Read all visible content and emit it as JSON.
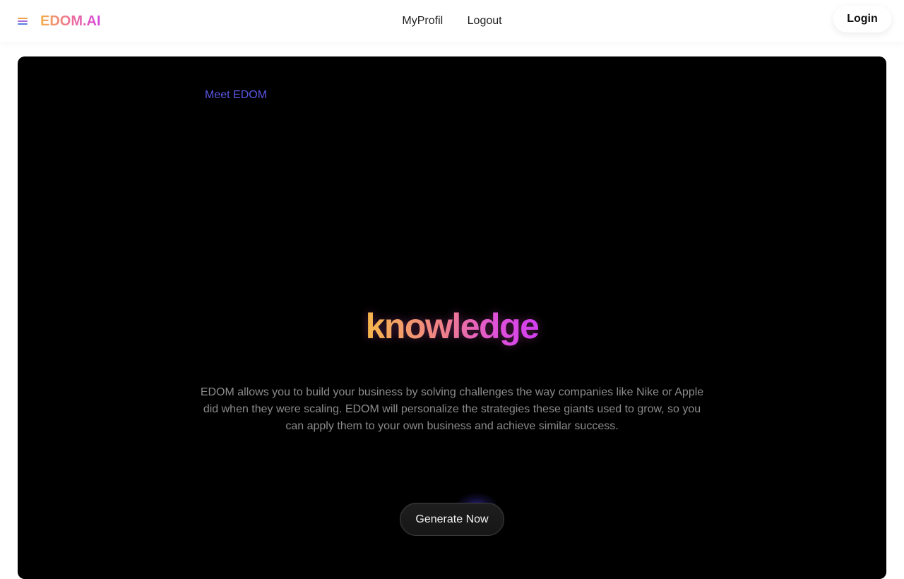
{
  "navbar": {
    "menu_icon": "hamburger-menu-icon",
    "brand": "EDOM.AI",
    "links": [
      {
        "label": "MyProfil"
      },
      {
        "label": "Logout"
      }
    ],
    "login_label": "Login"
  },
  "hero": {
    "eyebrow": "Meet EDOM",
    "headline": "knowledge",
    "description": "EDOM allows you to build your business by solving challenges the way companies like Nike or Apple did when they were scaling. EDOM will personalize the strategies these giants used to grow, so you can apply them to your own business and achieve similar success.",
    "cta_label": "Generate Now"
  },
  "colors": {
    "accent": "#5b57e6",
    "gradient_start": "#f3b049",
    "gradient_mid": "#ec6aa0",
    "gradient_end": "#d448e0",
    "hero_background": "#000000"
  }
}
